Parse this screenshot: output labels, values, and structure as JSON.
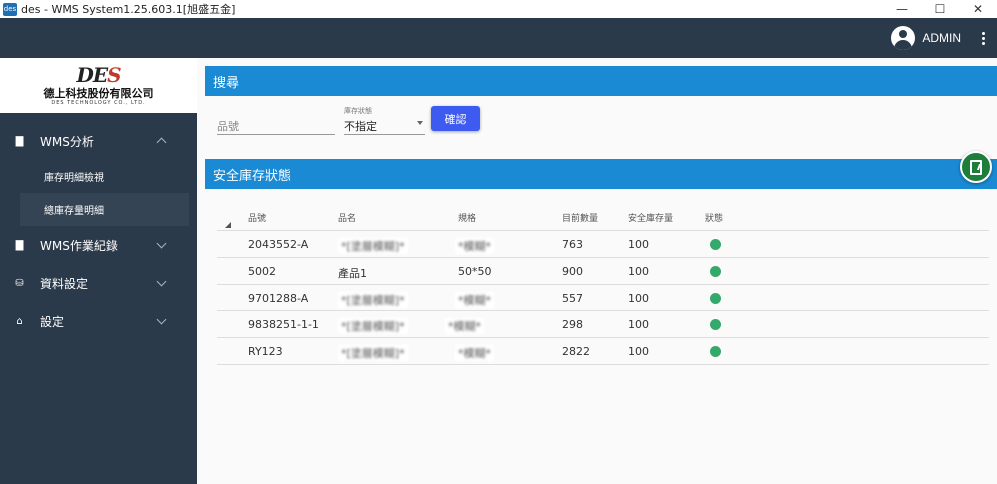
{
  "window": {
    "icon_text": "des",
    "title": "des - WMS System1.25.603.1[旭盛五金]"
  },
  "appbar": {
    "user_name": "ADMIN"
  },
  "logo": {
    "mark_text_a": "DE",
    "mark_text_b": "S",
    "company_cn": "德上科技股份有限公司",
    "company_en": "DES TECHNOLOGY CO., LTD."
  },
  "sidebar": {
    "items": [
      {
        "label": "WMS分析",
        "icon": "document-icon",
        "expanded": true,
        "children": [
          {
            "label": "庫存明細檢視",
            "active": false
          },
          {
            "label": "總庫存量明細",
            "active": true
          }
        ]
      },
      {
        "label": "WMS作業紀錄",
        "icon": "document-icon",
        "expanded": false
      },
      {
        "label": "資料設定",
        "icon": "database-icon",
        "expanded": false
      },
      {
        "label": "設定",
        "icon": "basket-icon",
        "expanded": false
      }
    ]
  },
  "search": {
    "section_title": "搜尋",
    "part_placeholder": "品號",
    "status_label": "庫存狀態",
    "status_value": "不指定",
    "confirm_label": "確認"
  },
  "safety_stock": {
    "section_title": "安全庫存狀態",
    "columns": [
      "品號",
      "品名",
      "規格",
      "目前數量",
      "安全庫存量",
      "狀態"
    ],
    "rows": [
      {
        "part_no": "2043552-A",
        "name": "*[塗層模糊]*",
        "spec": "*模糊*",
        "qty": "763",
        "safety": "100",
        "status": "ok"
      },
      {
        "part_no": "5002",
        "name": "產品1",
        "spec": "50*50",
        "qty": "900",
        "safety": "100",
        "status": "ok"
      },
      {
        "part_no": "9701288-A",
        "name": "*[塗層模糊]*",
        "spec": "*模糊*",
        "qty": "557",
        "safety": "100",
        "status": "ok"
      },
      {
        "part_no": "9838251-1-1",
        "name": "*[塗層模糊]*",
        "spec": "*模糊*",
        "qty": "298",
        "safety": "100",
        "status": "ok"
      },
      {
        "part_no": "RY123",
        "name": "*[塗層模糊]*",
        "spec": "*模糊*",
        "qty": "2822",
        "safety": "100",
        "status": "ok"
      }
    ]
  },
  "colors": {
    "appbar": "#2b3a4a",
    "section_bar": "#1a8ad4",
    "confirm_button": "#3d5af1",
    "status_ok": "#35a86b",
    "export_button": "#1e7d3a"
  }
}
